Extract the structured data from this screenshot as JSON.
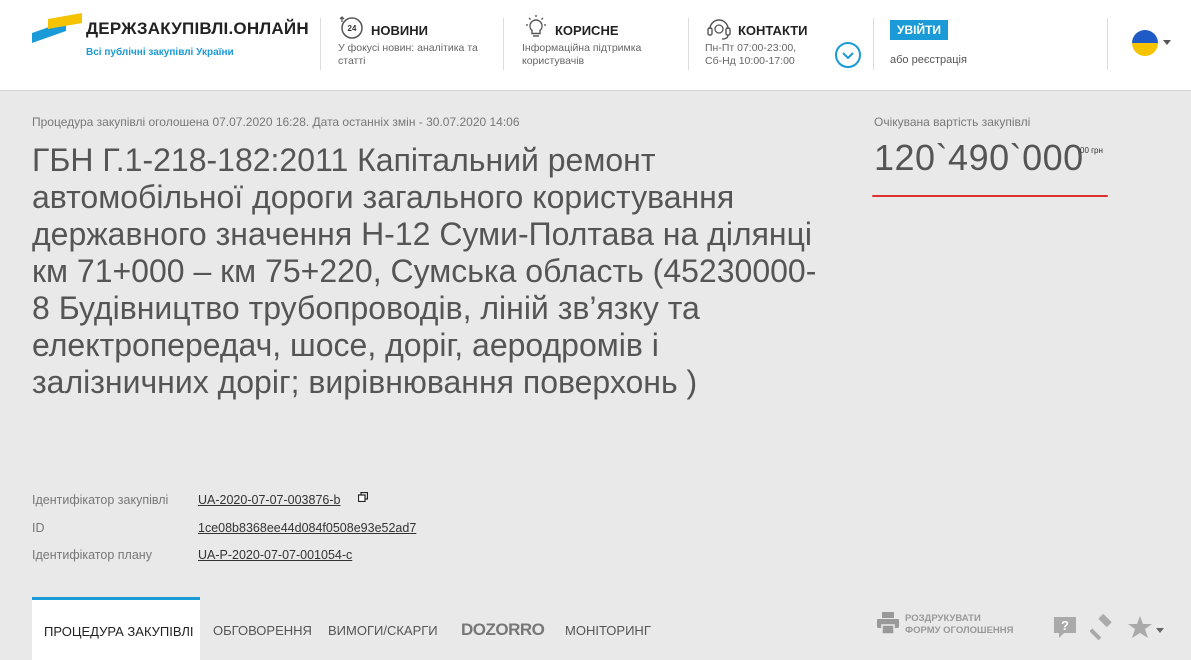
{
  "header": {
    "logo_title": "ДЕРЖЗАКУПІВЛІ.ОНЛАЙН",
    "logo_subtitle": "Всі публічні закупівлі України",
    "nav": [
      {
        "title": "НОВИНИ",
        "desc_line1": "У фокусі новин: аналітика та",
        "desc_line2": "статті",
        "icon": "news-24-icon"
      },
      {
        "title": "КОРИСНЕ",
        "desc_line1": "Інформаційна підтримка",
        "desc_line2": "користувачів",
        "icon": "lightbulb-icon"
      },
      {
        "title": "КОНТАКТИ",
        "desc_line1": "Пн-Пт 07:00-23:00,",
        "desc_line2": "Сб-Нд 10:00-17:00",
        "icon": "headset-icon"
      }
    ],
    "login_label": "УВІЙТИ",
    "register_label": "або реєстрація",
    "colors": {
      "accent": "#1a9ad6",
      "flag_blue": "#1f5bc6",
      "flag_yellow": "#f5c300"
    }
  },
  "main": {
    "announce": "Процедура закупівлі оголошена 07.07.2020 16:28. Дата останніх змін - 30.07.2020 14:06",
    "title": "ГБН Г.1-218-182:2011 Капітальний ремонт автомобільної дороги загального користування державного значення Н-12 Суми-Полтава на ділянці км 71+000 – км 75+220, Сумська область (45230000-8 Будівництво трубопроводів, ліній зв’язку та електропередач, шосе, доріг, аеродромів і залізничних доріг; вирівнювання поверхонь )",
    "expected_label": "Очікувана вартість закупівлі",
    "expected_value": "120`490`000",
    "expected_cents": "00 грн",
    "identifiers": [
      {
        "label": "Ідентифікатор закупівлі",
        "value": "UA-2020-07-07-003876-b"
      },
      {
        "label": "ID",
        "value": "1ce08b8368ee44d084f0508e93e52ad7"
      },
      {
        "label": "Ідентифікатор плану",
        "value": "UA-P-2020-07-07-001054-c"
      }
    ]
  },
  "tabs": {
    "procedure": "ПРОЦЕДУРА ЗАКУПІВЛІ",
    "discussion": "ОБГОВОРЕННЯ",
    "complaints": "ВИМОГИ/СКАРГИ",
    "dozorro": "DOZORRO",
    "monitoring": "МОНІТОРИНГ",
    "print_line1": "РОЗДРУКУВАТИ",
    "print_line2": "ФОРМУ ОГОЛОШЕННЯ"
  }
}
